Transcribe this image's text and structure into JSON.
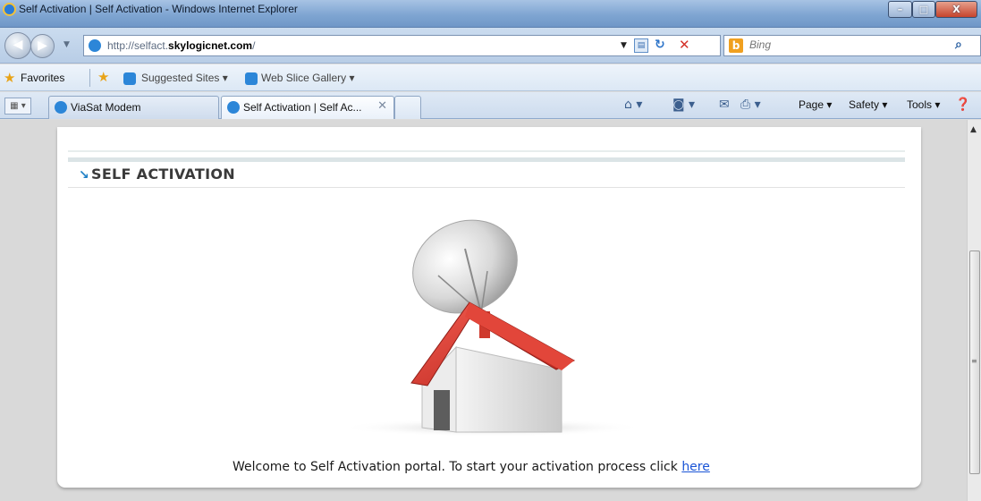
{
  "window": {
    "title": "Self Activation | Self Activation - Windows Internet Explorer",
    "minimize_glyph": "–",
    "maximize_glyph": "□",
    "close_glyph": "X"
  },
  "nav": {
    "url_prefix": "http://selfact.",
    "url_domain": "skylogicnet.com",
    "url_suffix": "/",
    "search_placeholder": "Bing"
  },
  "favorites": {
    "label": "Favorites",
    "links": [
      "Suggested Sites ▾",
      "Web Slice Gallery ▾"
    ]
  },
  "tabs": [
    {
      "label": "ViaSat Modem",
      "active": false
    },
    {
      "label": "Self Activation | Self Ac...",
      "active": true
    }
  ],
  "commands": [
    "Page ▾",
    "Safety ▾",
    "Tools ▾"
  ],
  "icons": {
    "home": "home-icon",
    "feeds": "feeds-icon",
    "mail": "mail-icon",
    "print": "print-icon",
    "help": "help-icon"
  },
  "page": {
    "section_title": "SELF ACTIVATION",
    "welcome_text": "Welcome to Self Activation portal. To start your activation process click ",
    "link_text": "here"
  }
}
